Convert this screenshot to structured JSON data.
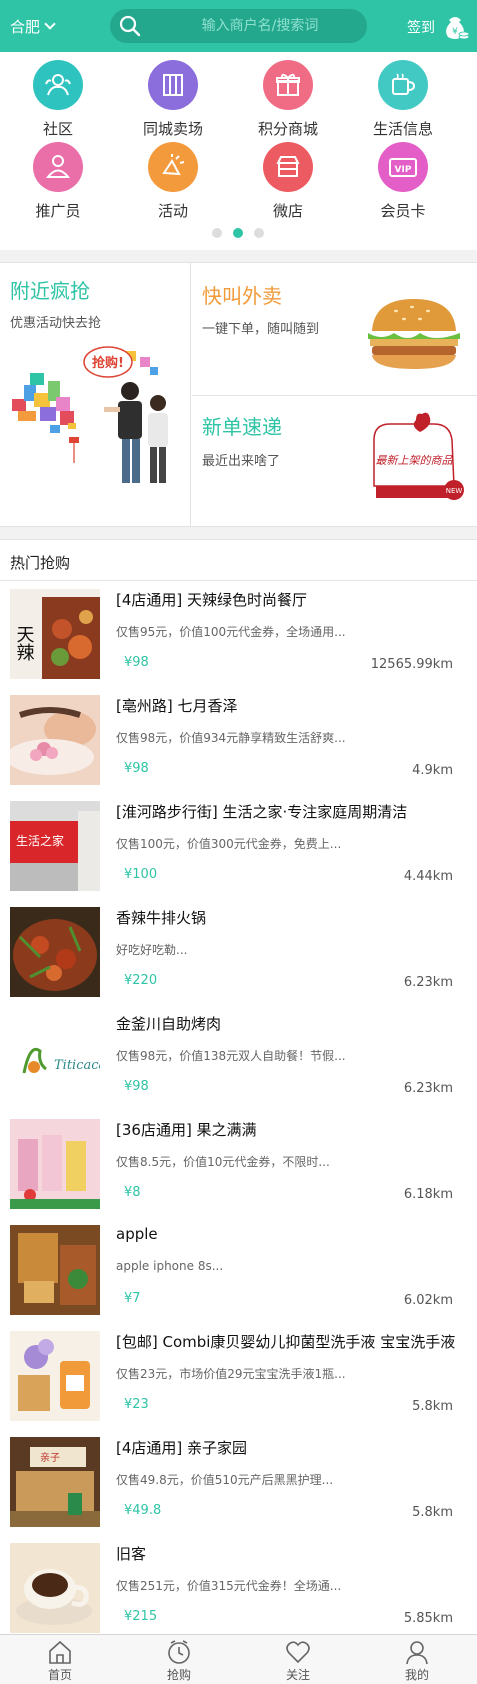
{
  "header": {
    "city": "合肥",
    "search_placeholder": "输入商户名/搜索词",
    "signin": "签到"
  },
  "categories": [
    {
      "label": "社区",
      "icon": "community-icon",
      "color": "#2fc3c0"
    },
    {
      "label": "同城卖场",
      "icon": "mall-icon",
      "color": "#8b6ddc"
    },
    {
      "label": "积分商城",
      "icon": "gift-icon",
      "color": "#f06b84"
    },
    {
      "label": "生活信息",
      "icon": "cup-icon",
      "color": "#43c9c4"
    },
    {
      "label": "推广员",
      "icon": "promoter-icon",
      "color": "#ea6ea8"
    },
    {
      "label": "活动",
      "icon": "activity-icon",
      "color": "#f39a3d"
    },
    {
      "label": "微店",
      "icon": "shop-icon",
      "color": "#ec5b61"
    },
    {
      "label": "会员卡",
      "icon": "vip-card-icon",
      "color": "#e35ec6"
    }
  ],
  "carousel": {
    "count": 3,
    "active": 1
  },
  "promo": {
    "left": {
      "title": "附近疯抢",
      "sub": "优惠活动快去抢",
      "badge": "抢购!"
    },
    "right_top": {
      "title": "快叫外卖",
      "sub": "一键下单，随叫随到"
    },
    "right_bottom": {
      "title": "新单速递",
      "sub": "最近出来啥了",
      "stamp": "最新上架的商品",
      "tag": "NEW"
    }
  },
  "hot": {
    "title": "热门抢购",
    "items": [
      {
        "name": "[4店通用] 天辣绿色时尚餐厅",
        "desc": "仅售95元，价值100元代金券，全场通用...",
        "price": "¥98",
        "distance": "12565.99km",
        "thumb_text": "天辣"
      },
      {
        "name": "[亳州路] 七月香泽",
        "desc": "仅售98元，价值934元静享精致生活舒爽...",
        "price": "¥98",
        "distance": "4.9km",
        "thumb_text": ""
      },
      {
        "name": "[淮河路步行街] 生活之家·专注家庭周期清洁",
        "desc": "仅售100元，价值300元代金券，免费上...",
        "price": "¥100",
        "distance": "4.44km",
        "thumb_text": "生活之家"
      },
      {
        "name": "香辣牛排火锅",
        "desc": "好吃好吃勒...",
        "price": "¥220",
        "distance": "6.23km",
        "thumb_text": ""
      },
      {
        "name": "金釜川自助烤肉",
        "desc": "仅售98元，价值138元双人自助餐！节假...",
        "price": "¥98",
        "distance": "6.23km",
        "thumb_text": "Titicaca"
      },
      {
        "name": "[36店通用] 果之满满",
        "desc": "仅售8.5元，价值10元代金券，不限时...",
        "price": "¥8",
        "distance": "6.18km",
        "thumb_text": ""
      },
      {
        "name": "apple",
        "desc": "apple iphone 8s...",
        "price": "¥7",
        "distance": "6.02km",
        "thumb_text": ""
      },
      {
        "name": "[包邮] Combi康贝婴幼儿抑菌型洗手液 宝宝洗手液",
        "desc": "仅售23元，市场价值29元宝宝洗手液1瓶...",
        "price": "¥23",
        "distance": "5.8km",
        "thumb_text": ""
      },
      {
        "name": "[4店通用] 亲子家园",
        "desc": "仅售49.8元，价值510元产后黑黑护理...",
        "price": "¥49.8",
        "distance": "5.8km",
        "thumb_text": "亲子"
      },
      {
        "name": "旧客",
        "desc": "仅售251元，价值315元代金券！全场通...",
        "price": "¥215",
        "distance": "5.85km",
        "thumb_text": ""
      }
    ]
  },
  "tabs": [
    {
      "label": "首页",
      "icon": "home-icon"
    },
    {
      "label": "抢购",
      "icon": "clock-icon"
    },
    {
      "label": "关注",
      "icon": "heart-icon"
    },
    {
      "label": "我的",
      "icon": "user-icon"
    }
  ]
}
